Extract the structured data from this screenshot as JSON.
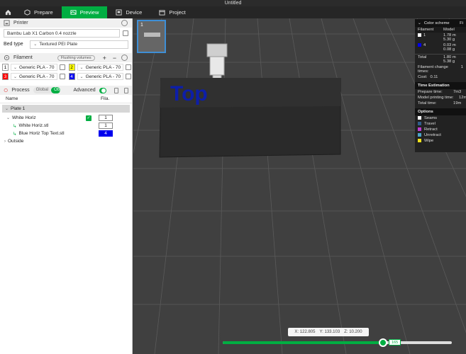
{
  "window": {
    "title": "Untitled"
  },
  "tabs": [
    {
      "label": "Prepare",
      "icon": "cube-icon"
    },
    {
      "label": "Preview",
      "icon": "preview-icon",
      "active": true
    },
    {
      "label": "Device",
      "icon": "device-icon"
    },
    {
      "label": "Project",
      "icon": "project-icon"
    }
  ],
  "printer": {
    "section_label": "Printer",
    "name": "Bambu Lab X1 Carbon 0.4 nozzle",
    "bed_type_label": "Bed type",
    "bed_type": "Textured PEI Plate"
  },
  "filament": {
    "section_label": "Filament",
    "flushing_label": "Flushing volumes",
    "items": [
      {
        "num": "1",
        "name": "Generic PLA - 70",
        "color": "#ffffff",
        "text_color": "#000000"
      },
      {
        "num": "2",
        "name": "Generic PLA - 70",
        "color": "#ffff00",
        "text_color": "#000000"
      },
      {
        "num": "3",
        "name": "Generic PLA - 70",
        "color": "#ff0000",
        "text_color": "#ffffff"
      },
      {
        "num": "4",
        "name": "Generic PLA - 70",
        "color": "#0000ee",
        "text_color": "#ffffff"
      }
    ]
  },
  "process": {
    "section_label": "Process",
    "global_label": "Global",
    "objects_label": "Objects",
    "advanced_label": "Advanced"
  },
  "objects": {
    "col_name": "Name",
    "col_fila": "Fila.",
    "plate": "Plate 1",
    "rows": [
      {
        "name": "White Horiz",
        "fila": "1"
      },
      {
        "name": "White Horiz.stl",
        "fila": "1"
      },
      {
        "name": "Blue Horiz Top Text.stl",
        "fila": "4"
      },
      {
        "name": "Outside"
      }
    ]
  },
  "viewport": {
    "plate_num": "1",
    "model_text": "Top"
  },
  "legend": {
    "header": "Color scheme",
    "header_extra": "Fi",
    "col_filament": "Filament",
    "col_model": "Model",
    "rows": [
      {
        "num": "1",
        "color": "#ffffff",
        "m1": "1.78 m",
        "m2": "5.30 g"
      },
      {
        "num": "4",
        "color": "#0000ee",
        "m1": "0.03 m",
        "m2": "0.08 g"
      }
    ],
    "total_label": "Total",
    "total_m": "1.80 m",
    "total_g": "5.38 g",
    "change_times_label": "Filament change times:",
    "change_times": "1",
    "cost_label": "Cost:",
    "cost": "0.11",
    "time_section": "Time Estimation",
    "prepare_label": "Prepare time:",
    "prepare_val": "7m3",
    "model_time_label": "Model printing time:",
    "model_time_val": "12m",
    "total_time_label": "Total time:",
    "total_time_val": "19m",
    "options_section": "Options",
    "options": [
      {
        "label": "Seams",
        "color": "#ffffff"
      },
      {
        "label": "Travel",
        "color": "#2f5d8a"
      },
      {
        "label": "Retract",
        "color": "#c03bd1"
      },
      {
        "label": "Unretract",
        "color": "#4aa3c8"
      },
      {
        "label": "Wipe",
        "color": "#f0e21a"
      }
    ]
  },
  "coords": {
    "x_label": "X:",
    "x": "122.805",
    "y_label": "Y:",
    "y": "133.103",
    "z_label": "Z:",
    "z": "10.200"
  },
  "layer_slider": {
    "value": "165",
    "fraction": 0.7
  }
}
